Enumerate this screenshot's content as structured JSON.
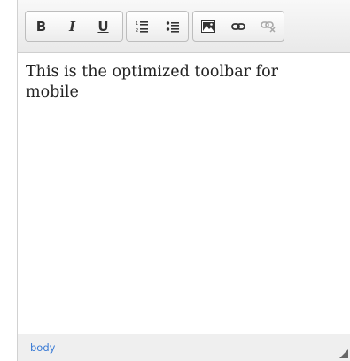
{
  "toolbar": {
    "bold_label": "B",
    "italic_label": "I",
    "underline_label": "U",
    "icons": [
      "numbered-list-icon",
      "bulleted-list-icon",
      "image-icon",
      "link-icon",
      "unlink-icon"
    ]
  },
  "content": {
    "text": "This is the optimized toolbar for mobile"
  },
  "statusbar": {
    "path": "body"
  },
  "colors": {
    "path_link": "#3a7bd5",
    "toolbar_bg": "#eeeeee"
  }
}
